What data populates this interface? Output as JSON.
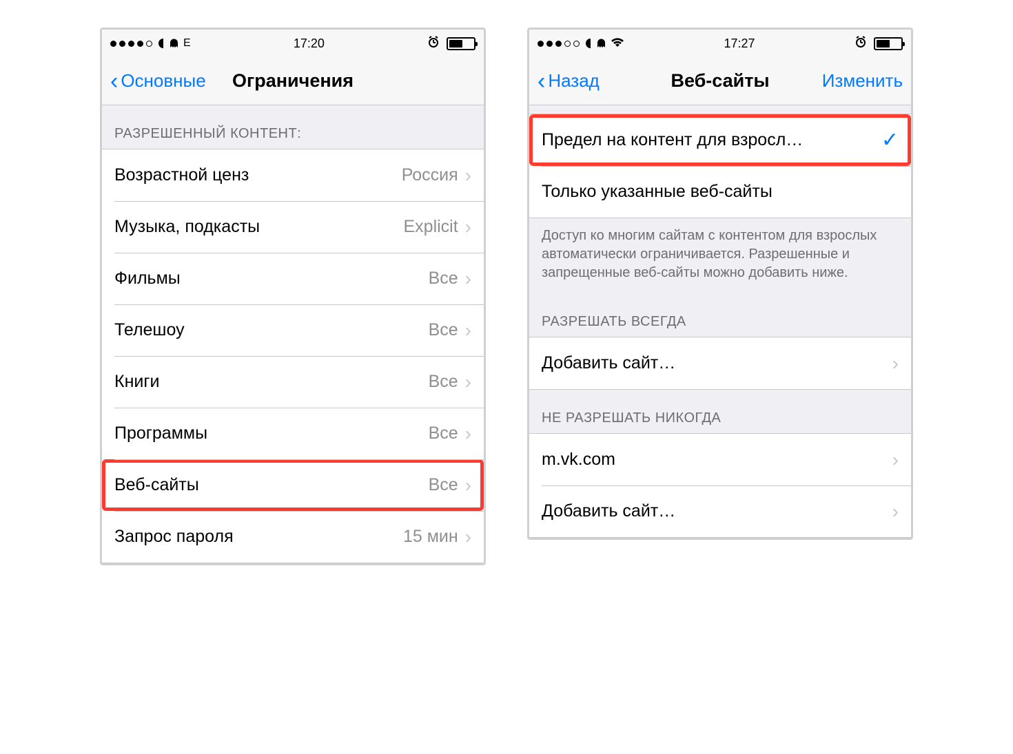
{
  "left": {
    "status": {
      "carrier": "E",
      "time": "17:20",
      "battery_pct": 55
    },
    "nav": {
      "back": "Основные",
      "title": "Ограничения"
    },
    "section_header": "РАЗРЕШЕННЫЙ КОНТЕНТ:",
    "rows": [
      {
        "label": "Возрастной ценз",
        "value": "Россия"
      },
      {
        "label": "Музыка, подкасты",
        "value": "Explicit"
      },
      {
        "label": "Фильмы",
        "value": "Все"
      },
      {
        "label": "Телешоу",
        "value": "Все"
      },
      {
        "label": "Книги",
        "value": "Все"
      },
      {
        "label": "Программы",
        "value": "Все"
      },
      {
        "label": "Веб-сайты",
        "value": "Все"
      },
      {
        "label": "Запрос пароля",
        "value": "15 мин"
      }
    ]
  },
  "right": {
    "status": {
      "time": "17:27",
      "battery_pct": 55
    },
    "nav": {
      "back": "Назад",
      "title": "Веб-сайты",
      "right": "Изменить"
    },
    "options": [
      {
        "label": "Предел на контент для взросл…",
        "checked": true
      },
      {
        "label": "Только указанные веб-сайты",
        "checked": false
      }
    ],
    "footer": "Доступ ко многим сайтам с контентом для взрослых автоматически ограничивается. Разрешенные и запрещенные веб-сайты можно добавить ниже.",
    "section_allow": "РАЗРЕШАТЬ ВСЕГДА",
    "allow_rows": [
      {
        "label": "Добавить сайт…"
      }
    ],
    "section_deny": "НЕ РАЗРЕШАТЬ НИКОГДА",
    "deny_rows": [
      {
        "label": "m.vk.com"
      },
      {
        "label": "Добавить сайт…"
      }
    ]
  }
}
